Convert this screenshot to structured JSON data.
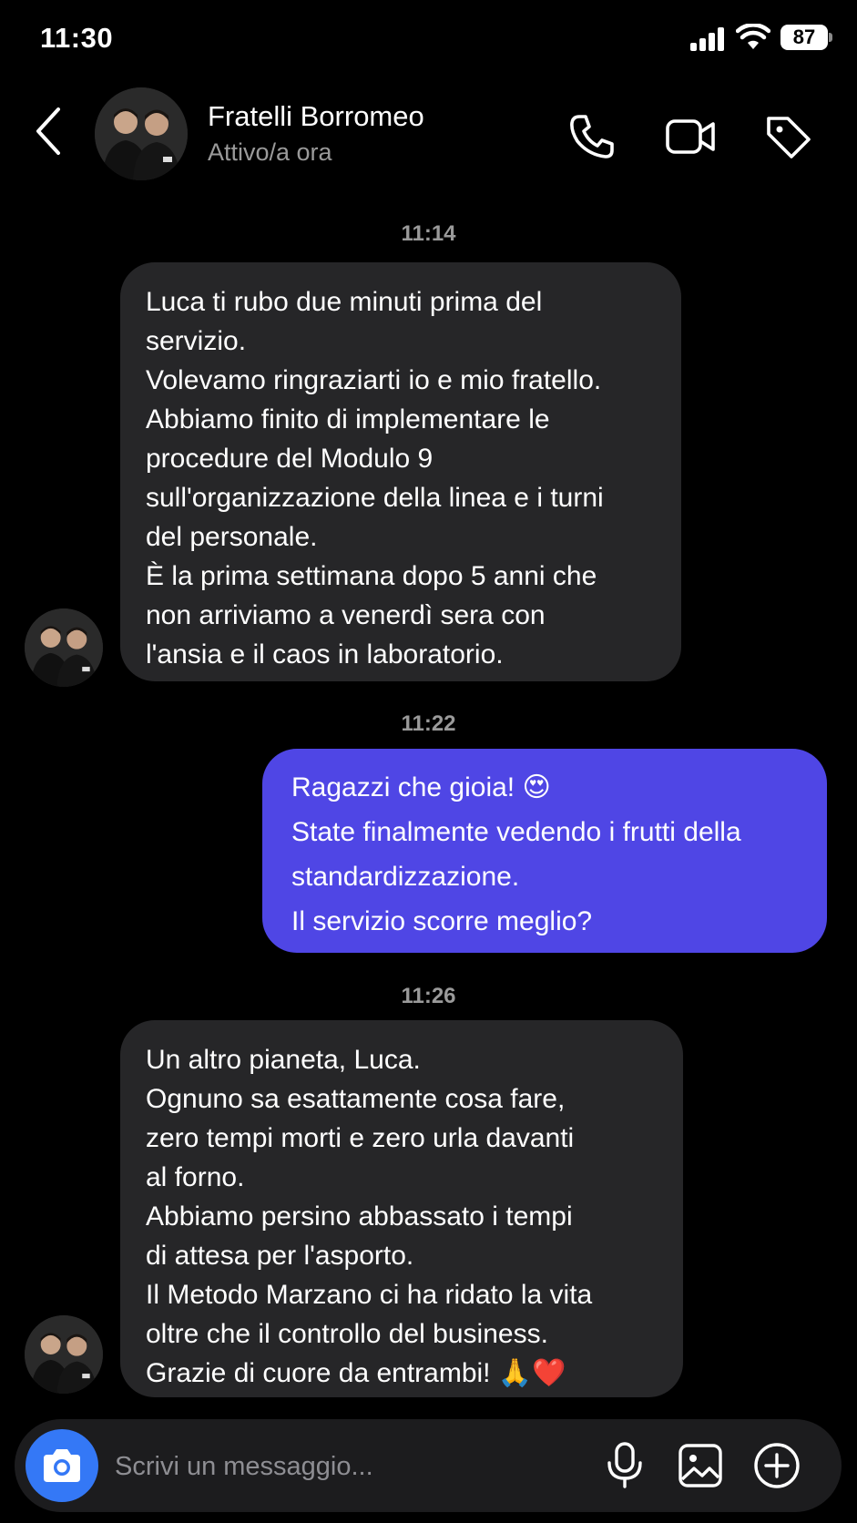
{
  "status_bar": {
    "time": "11:30",
    "battery": "87"
  },
  "header": {
    "contact_name": "Fratelli Borromeo",
    "contact_status": "Attivo/a ora",
    "icons": [
      "back-chevron-icon",
      "phone-icon",
      "video-camera-icon",
      "tag-icon"
    ]
  },
  "messages": [
    {
      "time": "11:14",
      "direction": "incoming",
      "lines": [
        "Luca ti rubo due minuti prima del",
        "servizio.",
        "Volevamo ringraziarti io e mio fratello.",
        "Abbiamo finito di implementare le",
        "procedure del Modulo 9",
        "sull'organizzazione della linea e i turni",
        "del personale.",
        "È la prima settimana dopo 5 anni che",
        "non arriviamo a venerdì sera con",
        "l'ansia e il caos in laboratorio."
      ]
    },
    {
      "time": "11:22",
      "direction": "outgoing",
      "lines": [
        "Ragazzi che gioia! 😍",
        "State finalmente vedendo i frutti della",
        "standardizzazione.",
        "Il servizio scorre meglio?"
      ]
    },
    {
      "time": "11:26",
      "direction": "incoming",
      "lines": [
        "Un altro pianeta, Luca.",
        "Ognuno sa esattamente cosa fare,",
        "zero tempi morti e zero urla davanti",
        "al forno.",
        "Abbiamo persino abbassato i tempi",
        "di attesa per l'asporto.",
        "Il Metodo Marzano ci ha ridato la vita",
        "oltre che il controllo del business.",
        "Grazie di cuore da entrambi! 🙏❤️"
      ]
    }
  ],
  "composer": {
    "placeholder": "Scrivi un messaggio...",
    "icons": [
      "camera-icon",
      "microphone-icon",
      "image-icon",
      "plus-icon"
    ]
  },
  "colors": {
    "background": "#000000",
    "incoming_bubble": "#262628",
    "outgoing_bubble": "#4f46e5",
    "camera_button": "#3478f6",
    "secondary_text": "#9a9a9a"
  }
}
